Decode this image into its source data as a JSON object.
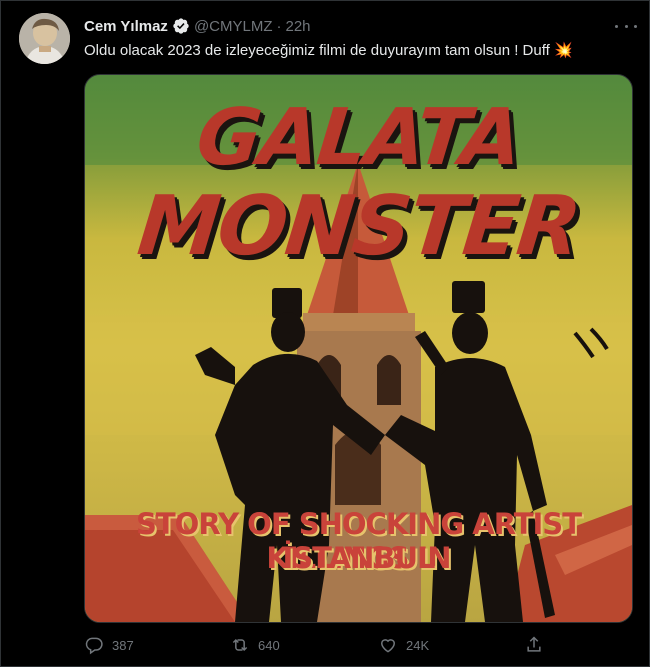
{
  "author": {
    "name": "Cem Yılmaz",
    "handle": "@CMYLMZ",
    "separator": "·",
    "time": "22h"
  },
  "tweet": {
    "text": "Oldu olacak 2023 de izleyeceğimiz filmi de duyurayım tam olsun ! Duff 💥"
  },
  "poster": {
    "title_line1": "GALATA",
    "title_line2": "MONSTER",
    "subtitle_line1": "STORY OF SHOCKING ARTIST KILLINGS IN",
    "subtitle_line2": "İSTANBUL"
  },
  "actions": {
    "replies": "387",
    "retweets": "640",
    "likes": "24K"
  },
  "icons": {
    "verified": "verified-badge-icon",
    "more": "more-icon",
    "reply": "reply-icon",
    "retweet": "retweet-icon",
    "like": "heart-icon",
    "share": "share-icon"
  },
  "colors": {
    "background": "#000000",
    "text_primary": "#e7e9ea",
    "text_secondary": "#71767b",
    "poster_red": "#b8382a"
  }
}
